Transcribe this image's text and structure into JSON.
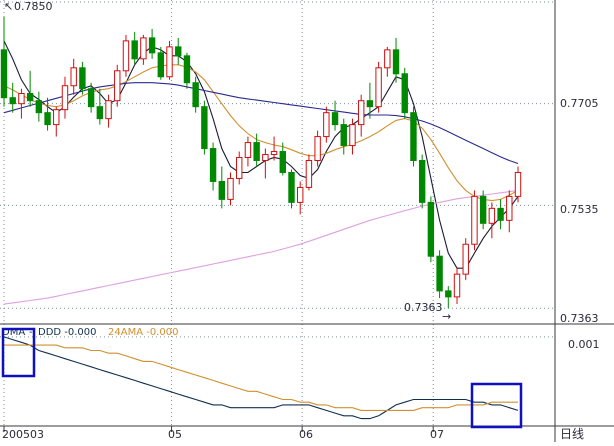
{
  "chart_data": [
    {
      "type": "candlestick",
      "y_ticks": [
        "0.7705",
        "0.7535",
        "0.7363"
      ],
      "y_tick_values": [
        0.7705,
        0.7535,
        0.7363
      ],
      "x_ticks": [
        "200503",
        "05",
        "06",
        "07"
      ],
      "period_label": "日线",
      "ylim": [
        0.734,
        0.7875
      ],
      "annotations": {
        "high_label": "0.7850",
        "low_label": "0.7363",
        "low_arrow": "→"
      },
      "series": [
        {
          "name": "candles",
          "color_up": "#d01010",
          "color_down": "#008800",
          "ohlc": [
            [
              0.7795,
              0.785,
              0.77,
              0.7715
            ],
            [
              0.7715,
              0.774,
              0.769,
              0.7705
            ],
            [
              0.7705,
              0.773,
              0.768,
              0.7722
            ],
            [
              0.7722,
              0.776,
              0.77,
              0.771
            ],
            [
              0.771,
              0.7725,
              0.7675,
              0.769
            ],
            [
              0.769,
              0.7715,
              0.766,
              0.767
            ],
            [
              0.767,
              0.77,
              0.765,
              0.7695
            ],
            [
              0.7695,
              0.775,
              0.768,
              0.7735
            ],
            [
              0.7735,
              0.778,
              0.772,
              0.7765
            ],
            [
              0.7765,
              0.7775,
              0.772,
              0.773
            ],
            [
              0.773,
              0.774,
              0.769,
              0.77
            ],
            [
              0.77,
              0.773,
              0.767,
              0.768
            ],
            [
              0.768,
              0.772,
              0.7665,
              0.771
            ],
            [
              0.771,
              0.777,
              0.77,
              0.776
            ],
            [
              0.776,
              0.782,
              0.775,
              0.781
            ],
            [
              0.781,
              0.7825,
              0.777,
              0.778
            ],
            [
              0.778,
              0.782,
              0.777,
              0.7815
            ],
            [
              0.7815,
              0.783,
              0.778,
              0.779
            ],
            [
              0.779,
              0.78,
              0.7745,
              0.775
            ],
            [
              0.775,
              0.781,
              0.7745,
              0.78
            ],
            [
              0.78,
              0.7815,
              0.777,
              0.7785
            ],
            [
              0.7785,
              0.779,
              0.773,
              0.774
            ],
            [
              0.774,
              0.775,
              0.769,
              0.77
            ],
            [
              0.77,
              0.771,
              0.762,
              0.763
            ],
            [
              0.763,
              0.764,
              0.756,
              0.7575
            ],
            [
              0.7575,
              0.76,
              0.753,
              0.7545
            ],
            [
              0.7545,
              0.759,
              0.7535,
              0.758
            ],
            [
              0.758,
              0.7625,
              0.757,
              0.7615
            ],
            [
              0.7615,
              0.765,
              0.76,
              0.764
            ],
            [
              0.764,
              0.7655,
              0.76,
              0.761
            ],
            [
              0.761,
              0.763,
              0.758,
              0.762
            ],
            [
              0.762,
              0.765,
              0.761,
              0.7625
            ],
            [
              0.7625,
              0.764,
              0.7585,
              0.759
            ],
            [
              0.759,
              0.7595,
              0.753,
              0.754
            ],
            [
              0.754,
              0.7575,
              0.752,
              0.7565
            ],
            [
              0.7565,
              0.762,
              0.756,
              0.761
            ],
            [
              0.761,
              0.766,
              0.76,
              0.765
            ],
            [
              0.765,
              0.77,
              0.764,
              0.769
            ],
            [
              0.769,
              0.771,
              0.766,
              0.767
            ],
            [
              0.767,
              0.768,
              0.762,
              0.7635
            ],
            [
              0.7635,
              0.768,
              0.762,
              0.767
            ],
            [
              0.767,
              0.772,
              0.765,
              0.771
            ],
            [
              0.771,
              0.774,
              0.768,
              0.77
            ],
            [
              0.77,
              0.7775,
              0.769,
              0.7765
            ],
            [
              0.7765,
              0.78,
              0.775,
              0.7795
            ],
            [
              0.7795,
              0.7815,
              0.774,
              0.7755
            ],
            [
              0.7755,
              0.7765,
              0.768,
              0.769
            ],
            [
              0.769,
              0.77,
              0.76,
              0.761
            ],
            [
              0.761,
              0.762,
              0.753,
              0.754
            ],
            [
              0.754,
              0.755,
              0.744,
              0.745
            ],
            [
              0.745,
              0.746,
              0.738,
              0.7392
            ],
            [
              0.7392,
              0.74,
              0.7363,
              0.7382
            ],
            [
              0.7382,
              0.743,
              0.737,
              0.742
            ],
            [
              0.742,
              0.748,
              0.741,
              0.747
            ],
            [
              0.747,
              0.756,
              0.746,
              0.755
            ],
            [
              0.755,
              0.756,
              0.7495,
              0.7505
            ],
            [
              0.7505,
              0.754,
              0.748,
              0.753
            ],
            [
              0.753,
              0.7545,
              0.7495,
              0.751
            ],
            [
              0.751,
              0.756,
              0.749,
              0.755
            ],
            [
              0.755,
              0.76,
              0.754,
              0.759
            ]
          ]
        },
        {
          "name": "ma_short",
          "color": "#1a1a3a",
          "values": [
            0.781,
            0.778,
            0.7745,
            0.7722,
            0.7712,
            0.77,
            0.769,
            0.77,
            0.7716,
            0.773,
            0.7735,
            0.7722,
            0.7705,
            0.7712,
            0.774,
            0.777,
            0.779,
            0.78,
            0.7795,
            0.7785,
            0.7785,
            0.7775,
            0.7755,
            0.7725,
            0.768,
            0.763,
            0.76,
            0.759,
            0.759,
            0.76,
            0.761,
            0.7615,
            0.7612,
            0.76,
            0.7585,
            0.758,
            0.7595,
            0.7625,
            0.765,
            0.7665,
            0.767,
            0.768,
            0.769,
            0.77,
            0.7725,
            0.775,
            0.7745,
            0.7705,
            0.765,
            0.758,
            0.751,
            0.7455,
            0.743,
            0.743,
            0.7455,
            0.748,
            0.75,
            0.7515,
            0.753,
            0.755
          ]
        },
        {
          "name": "ma_mid",
          "color": "#d09030",
          "values": [
            0.7735,
            0.7728,
            0.772,
            0.7712,
            0.7706,
            0.7702,
            0.77,
            0.7703,
            0.771,
            0.7718,
            0.7724,
            0.7728,
            0.773,
            0.7735,
            0.7742,
            0.775,
            0.7758,
            0.7765,
            0.7768,
            0.777,
            0.777,
            0.7766,
            0.7758,
            0.7745,
            0.7725,
            0.7705,
            0.7685,
            0.7668,
            0.7655,
            0.7645,
            0.764,
            0.7636,
            0.7633,
            0.7628,
            0.7622,
            0.7618,
            0.7618,
            0.7622,
            0.7628,
            0.7633,
            0.7637,
            0.7643,
            0.765,
            0.7658,
            0.7668,
            0.7677,
            0.768,
            0.7676,
            0.7664,
            0.7645,
            0.7622,
            0.7598,
            0.7576,
            0.756,
            0.755,
            0.7545,
            0.7543,
            0.7545,
            0.7552,
            0.756
          ]
        },
        {
          "name": "ma_long",
          "color": "#2a2a90",
          "values": [
            0.769,
            0.7694,
            0.7698,
            0.7702,
            0.7706,
            0.771,
            0.7714,
            0.7718,
            0.7722,
            0.7726,
            0.773,
            0.7733,
            0.7735,
            0.7737,
            0.7739,
            0.774,
            0.774,
            0.774,
            0.7739,
            0.7738,
            0.7736,
            0.7733,
            0.773,
            0.7727,
            0.7724,
            0.7721,
            0.7718,
            0.7715,
            0.7713,
            0.7711,
            0.7709,
            0.7707,
            0.7705,
            0.7703,
            0.7701,
            0.7699,
            0.7697,
            0.7695,
            0.7693,
            0.7691,
            0.7689,
            0.7687,
            0.7686,
            0.7686,
            0.7686,
            0.7685,
            0.7683,
            0.768,
            0.7676,
            0.7671,
            0.7665,
            0.7658,
            0.7651,
            0.7644,
            0.7637,
            0.763,
            0.7623,
            0.7616,
            0.761,
            0.7605
          ]
        },
        {
          "name": "ma_vlong",
          "color": "#e0a0e0",
          "values": [
            0.737,
            0.7372,
            0.7374,
            0.7376,
            0.7378,
            0.738,
            0.7383,
            0.7386,
            0.7389,
            0.7392,
            0.7395,
            0.7398,
            0.7401,
            0.7404,
            0.7407,
            0.741,
            0.7413,
            0.7416,
            0.7419,
            0.7422,
            0.7425,
            0.7428,
            0.7431,
            0.7434,
            0.7437,
            0.744,
            0.7443,
            0.7446,
            0.7449,
            0.7452,
            0.7455,
            0.7458,
            0.7462,
            0.7466,
            0.747,
            0.7475,
            0.748,
            0.7485,
            0.749,
            0.7495,
            0.75,
            0.7505,
            0.751,
            0.7514,
            0.7518,
            0.7522,
            0.7526,
            0.753,
            0.7534,
            0.7537,
            0.754,
            0.7543,
            0.7546,
            0.7548,
            0.755,
            0.7552,
            0.7554,
            0.7556,
            0.7558,
            0.756
          ]
        }
      ]
    },
    {
      "type": "line",
      "legend": [
        {
          "label": "DMA",
          "color": "#103050"
        },
        {
          "label": "-",
          "color": "#103050"
        },
        {
          "label": "DDD -0.000",
          "color": "#103050"
        },
        {
          "label": "24AMA -0.000",
          "color": "#d09030"
        }
      ],
      "y_ticks": [
        "0.001"
      ],
      "y_tick_values": [
        0.001
      ],
      "ylim": [
        -0.0022,
        0.0014
      ],
      "series": [
        {
          "name": "DMA",
          "color": "#103050",
          "values": [
            0.001,
            0.0009,
            0.0008,
            0.0007,
            0.0005,
            0.0004,
            0.0003,
            0.0002,
            0.0001,
            0.0,
            -0.0001,
            -0.0002,
            -0.0003,
            -0.0004,
            -0.0005,
            -0.0006,
            -0.0007,
            -0.0008,
            -0.0009,
            -0.001,
            -0.0011,
            -0.0012,
            -0.0013,
            -0.0014,
            -0.0015,
            -0.0015,
            -0.0016,
            -0.0016,
            -0.0016,
            -0.0016,
            -0.0016,
            -0.0016,
            -0.0015,
            -0.0015,
            -0.0015,
            -0.0015,
            -0.0016,
            -0.0017,
            -0.0018,
            -0.0019,
            -0.0019,
            -0.002,
            -0.002,
            -0.0019,
            -0.0017,
            -0.0015,
            -0.0014,
            -0.0013,
            -0.0013,
            -0.0013,
            -0.0013,
            -0.0013,
            -0.0013,
            -0.0013,
            -0.0014,
            -0.0014,
            -0.0015,
            -0.0015,
            -0.0016,
            -0.0017
          ]
        },
        {
          "name": "24AMA",
          "color": "#d09030",
          "values": [
            0.0007,
            0.0007,
            0.0007,
            0.0007,
            0.0007,
            0.0007,
            0.0007,
            0.0006,
            0.0006,
            0.0006,
            0.0005,
            0.0005,
            0.0004,
            0.0004,
            0.0003,
            0.0002,
            0.0001,
            0.0001,
            0.0,
            -0.0001,
            -0.0002,
            -0.0003,
            -0.0004,
            -0.0005,
            -0.0006,
            -0.0007,
            -0.0008,
            -0.0009,
            -0.001,
            -0.001,
            -0.0011,
            -0.0012,
            -0.0013,
            -0.0013,
            -0.0014,
            -0.0014,
            -0.0015,
            -0.0015,
            -0.0016,
            -0.0016,
            -0.0016,
            -0.0017,
            -0.0017,
            -0.0017,
            -0.0017,
            -0.0017,
            -0.0017,
            -0.0017,
            -0.0016,
            -0.0016,
            -0.0016,
            -0.0016,
            -0.0015,
            -0.0015,
            -0.0015,
            -0.0015,
            -0.0014,
            -0.0014,
            -0.0014,
            -0.0014
          ]
        }
      ]
    }
  ],
  "style": {
    "grid_color": "#7a90a0",
    "axis_color": "#3a3a3a",
    "highlight_box_color": "#1010c0",
    "text_color": "#2a2a3a"
  }
}
